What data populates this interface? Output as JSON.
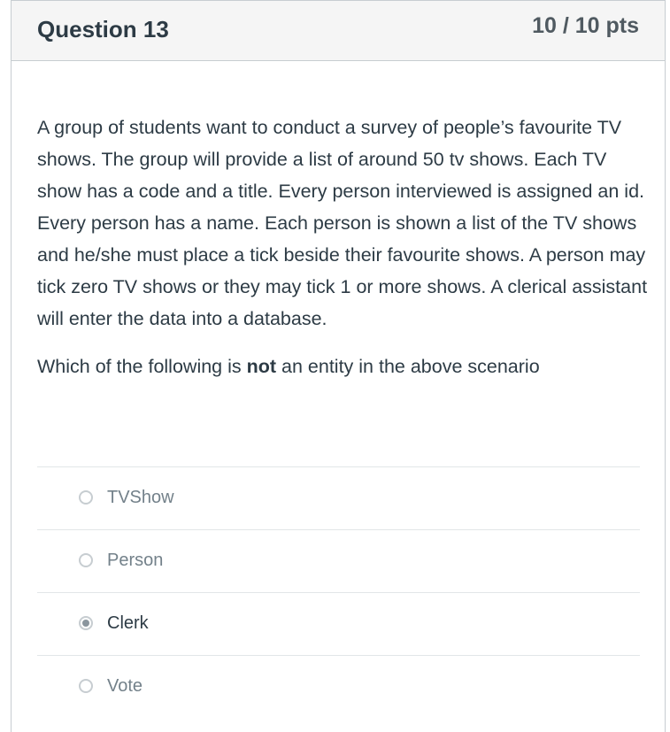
{
  "question": {
    "title": "Question 13",
    "points": "10 / 10 pts",
    "text": "A group of students want to conduct a survey of people’s favourite TV shows. The group will provide a list of around 50 tv shows. Each TV show has a code and a title. Every person interviewed is assigned an id. Every person has a name. Each person is shown a list of the TV shows and he/she must place a tick beside their favourite shows. A person may tick zero TV shows or they may tick 1 or more shows. A clerical assistant will enter the data into a database.",
    "prompt_before": "Which of the following is ",
    "prompt_bold": "not",
    "prompt_after": " an entity in the above scenario"
  },
  "answers": [
    {
      "label": "TVShow",
      "selected": false
    },
    {
      "label": "Person",
      "selected": false
    },
    {
      "label": "Clerk",
      "selected": true
    },
    {
      "label": "Vote",
      "selected": false
    }
  ]
}
